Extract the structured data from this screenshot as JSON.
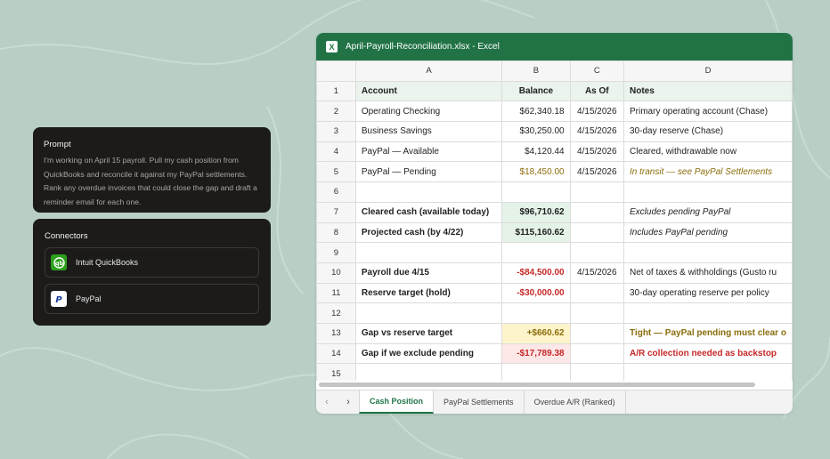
{
  "prompt": {
    "title": "Prompt",
    "text": "I'm working on April 15 payroll. Pull my cash position from QuickBooks and reconcile it against my PayPal settlements. Rank any overdue invoices that could close the gap and draft a reminder email for each one."
  },
  "connectors": {
    "title": "Connectors",
    "items": [
      {
        "label": "Intuit QuickBooks",
        "icon": "quickbooks-icon"
      },
      {
        "label": "PayPal",
        "icon": "paypal-icon"
      }
    ]
  },
  "excel": {
    "title": "April-Payroll-Reconciliation.xlsx - Excel",
    "columns": [
      "A",
      "B",
      "C",
      "D"
    ],
    "rows": [
      {
        "n": "1",
        "a": "Account",
        "b": "Balance",
        "c": "As Of",
        "d": "Notes"
      },
      {
        "n": "2",
        "a": "Operating Checking",
        "b": "$62,340.18",
        "c": "4/15/2026",
        "d": "Primary operating account (Chase)"
      },
      {
        "n": "3",
        "a": "Business Savings",
        "b": "$30,250.00",
        "c": "4/15/2026",
        "d": "30-day reserve (Chase)"
      },
      {
        "n": "4",
        "a": "PayPal — Available",
        "b": "$4,120.44",
        "c": "4/15/2026",
        "d": "Cleared, withdrawable now"
      },
      {
        "n": "5",
        "a": "PayPal — Pending",
        "b": "$18,450.00",
        "c": "4/15/2026",
        "d": "In transit — see PayPal Settlements"
      },
      {
        "n": "6",
        "a": "",
        "b": "",
        "c": "",
        "d": ""
      },
      {
        "n": "7",
        "a": "Cleared cash (available today)",
        "b": "$96,710.62",
        "c": "",
        "d": "Excludes pending PayPal"
      },
      {
        "n": "8",
        "a": "Projected cash (by 4/22)",
        "b": "$115,160.62",
        "c": "",
        "d": "Includes PayPal pending"
      },
      {
        "n": "9",
        "a": "",
        "b": "",
        "c": "",
        "d": ""
      },
      {
        "n": "10",
        "a": "Payroll due 4/15",
        "b": "-$84,500.00",
        "c": "4/15/2026",
        "d": "Net of taxes & withholdings (Gusto ru"
      },
      {
        "n": "11",
        "a": "Reserve target (hold)",
        "b": "-$30,000.00",
        "c": "",
        "d": "30-day operating reserve per policy"
      },
      {
        "n": "12",
        "a": "",
        "b": "",
        "c": "",
        "d": ""
      },
      {
        "n": "13",
        "a": "Gap vs reserve target",
        "b": "+$660.62",
        "c": "",
        "d": "Tight — PayPal pending must clear o"
      },
      {
        "n": "14",
        "a": "Gap if we exclude pending",
        "b": "-$17,789.38",
        "c": "",
        "d": "A/R collection needed as backstop"
      },
      {
        "n": "15",
        "a": "",
        "b": "",
        "c": "",
        "d": ""
      }
    ],
    "tabs": [
      "Cash Position",
      "PayPal Settlements",
      "Overdue A/R (Ranked)"
    ],
    "active_tab": "Cash Position",
    "colors": {
      "brand": "#217346",
      "negative": "#c62828",
      "warning": "#8a6d0a"
    }
  }
}
